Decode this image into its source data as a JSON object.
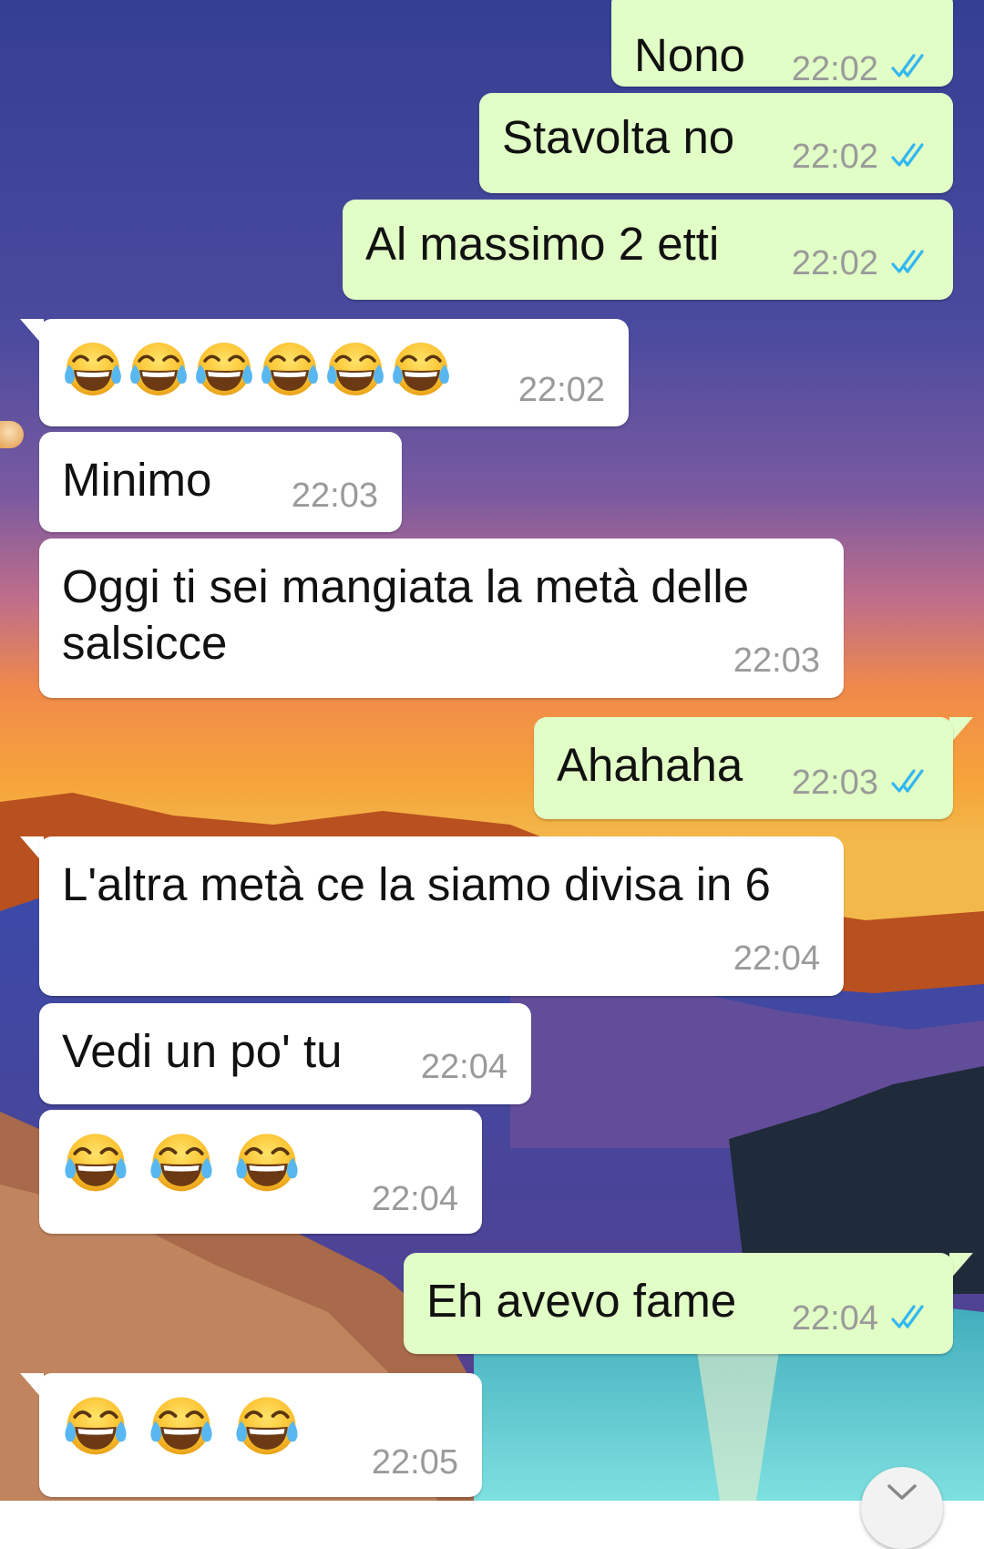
{
  "chat": {
    "messages": [
      {
        "direction": "out",
        "text": "Nono",
        "time": "22:02",
        "status": "read"
      },
      {
        "direction": "out",
        "text": "Stavolta no",
        "time": "22:02",
        "status": "read"
      },
      {
        "direction": "out",
        "text": "Al massimo 2 etti",
        "time": "22:02",
        "status": "read"
      },
      {
        "direction": "in",
        "emoji": "tears-of-joy",
        "emoji_count": 6,
        "time": "22:02"
      },
      {
        "direction": "in",
        "text": "Minimo",
        "time": "22:03"
      },
      {
        "direction": "in",
        "text": "Oggi ti sei mangiata la metà delle",
        "text2": "salsicce",
        "time": "22:03"
      },
      {
        "direction": "out",
        "text": "Ahahaha",
        "time": "22:03",
        "status": "read"
      },
      {
        "direction": "in",
        "text": "L'altra metà ce la siamo divisa in 6",
        "time": "22:04"
      },
      {
        "direction": "in",
        "text": "Vedi un po' tu",
        "time": "22:04"
      },
      {
        "direction": "in",
        "emoji": "tears-of-joy",
        "emoji_count": 3,
        "time": "22:04"
      },
      {
        "direction": "out",
        "text": "Eh avevo fame",
        "time": "22:04",
        "status": "read"
      },
      {
        "direction": "in",
        "emoji": "tears-of-joy",
        "emoji_count": 3,
        "time": "22:05"
      }
    ]
  },
  "colors": {
    "outgoing_bubble": "#e1fec6",
    "incoming_bubble": "#ffffff",
    "read_ticks": "#34b7f1",
    "timestamp": "#9a9a9a"
  },
  "icons": {
    "read_receipt": "double-check-icon",
    "emoji": "face-with-tears-of-joy-icon",
    "scroll_button": "chevron-down-icon"
  }
}
